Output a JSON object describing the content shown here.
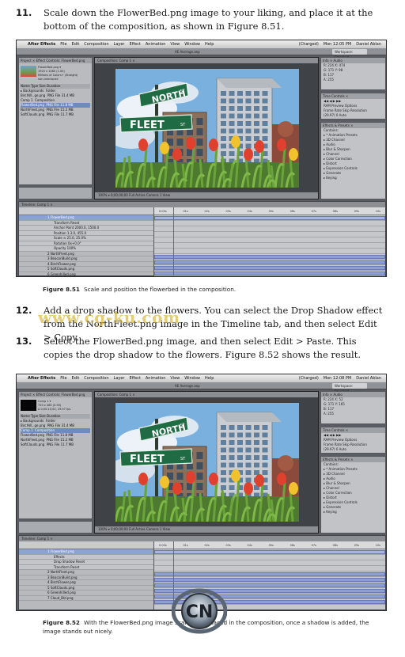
{
  "steps": [
    {
      "num": "11.",
      "text": "Scale down the FlowerBed.png image to your liking, and place it at the bottom of the composition, as shown in Figure 8.51."
    },
    {
      "num": "12.",
      "text": "Add a drop shadow to the flowers. You can select the Drop Shadow effect from the NorthFleet.png image in the Timeline tab, and then select Edit > Copy."
    },
    {
      "num": "13.",
      "text": "Select the FlowerBed.png image, and then select Edit > Paste. This copies the drop shadow to the flowers. Figure 8.52 shows the result."
    }
  ],
  "figures": [
    {
      "menubar": {
        "apple": "",
        "app": "After Effects",
        "items": [
          "File",
          "Edit",
          "Composition",
          "Layer",
          "Effect",
          "Animation",
          "View",
          "Window",
          "Help"
        ],
        "battery": "(Charged)",
        "clock": "Mon 12:05 PM",
        "user": "Daniel Ablan"
      },
      "toolbar": {
        "title": "AE Average.aep",
        "workspace": "Workspace: Standard"
      },
      "project": {
        "tab": "Project ×   Effect Controls: FlowerBed.png",
        "thumb_title": "FlowerBed.png ▾",
        "thumb_info": "1920 x 1080 (1.00)",
        "thumb_note": "Millions of Colors+ (Straight)",
        "thumb_note2": "non-interlaced",
        "columns": "Name       Type    Size   Duration",
        "items": [
          {
            "name": "▸ Backgrounds",
            "type": "Folder",
            "sel": false
          },
          {
            "name": "BirchW...ge.png",
            "type": "PNG File  31.4 MB",
            "sel": false
          },
          {
            "name": "Comp 1",
            "type": "Composition",
            "sel": false
          },
          {
            "name": "FlowerBed.png",
            "type": "PNG File  11.8 MB",
            "sel": true
          },
          {
            "name": "NorthFleet.png",
            "type": "PNG File  15.2 MB",
            "sel": false
          },
          {
            "name": "SoftClouds.png",
            "type": "PNG File  11.7 MB",
            "sel": false
          }
        ]
      },
      "comp": {
        "tab": "Composition: Comp 1 ×",
        "footer": "100%   ▾   0;00;00;00   Full   Active Camera   1 View"
      },
      "scene": {
        "sign1": "NORTH",
        "sign1_suffix": "ST",
        "sign2": "FLEET",
        "sign2_suffix": "ST"
      },
      "info": {
        "title": "Info ×  Audio",
        "rows": [
          "R: 224   X: 474",
          "G: 171   Y: 98",
          "B: 117",
          "A: 255"
        ]
      },
      "time_controls": {
        "title": "Time Controls ×",
        "rows": [
          "◀◀  ◀  ▶  ▶▶",
          "RAM Preview Options",
          "Frame Rate  Skip  Resolution",
          "(29.97)  0   Auto"
        ]
      },
      "effects": {
        "title": "Effects & Presets ×",
        "rows": [
          "Contains:",
          "▸ * Animation Presets",
          "▸ 3D Channel",
          "▸ Audio",
          "▸ Blur & Sharpen",
          "▸ Channel",
          "▸ Color Correction",
          "▸ Distort",
          "▸ Expression Controls",
          "▸ Generate",
          "▸ Keying"
        ]
      },
      "timeline": {
        "tab": "Timeline: Comp 1 ×",
        "ruler": [
          "0:00s",
          "01s",
          "02s",
          "03s",
          "04s",
          "05s",
          "06s",
          "07s",
          "08s",
          "09s",
          "10s"
        ],
        "layers": [
          {
            "name": "1  FlowerBed.png",
            "kind": "sel"
          },
          {
            "name": "Transform           Reset",
            "kind": "sub"
          },
          {
            "name": "Anchor Point   2000.0, 1500.0",
            "kind": "sub"
          },
          {
            "name": "Position        1.3.0, 455.0",
            "kind": "sub"
          },
          {
            "name": "Scale          ⊙ 25.0, 25.0%",
            "kind": "sub"
          },
          {
            "name": "Rotation        0x+0.0°",
            "kind": "sub"
          },
          {
            "name": "Opacity         100%",
            "kind": "sub"
          },
          {
            "name": "2  NorthFleet.png",
            "kind": "layer"
          },
          {
            "name": "3  BeaconBuild.png",
            "kind": "layer"
          },
          {
            "name": "4  BirchFlower.png",
            "kind": "layer"
          },
          {
            "name": "5  SoftClouds.png",
            "kind": "layer"
          },
          {
            "name": "6  Greenhilled.png",
            "kind": "layer"
          },
          {
            "name": "7  Cloud_Bld.png",
            "kind": "layer"
          }
        ]
      }
    },
    {
      "menubar": {
        "apple": "",
        "app": "After Effects",
        "items": [
          "File",
          "Edit",
          "Composition",
          "Layer",
          "Effect",
          "Animation",
          "View",
          "Window",
          "Help"
        ],
        "battery": "(Charged)",
        "clock": "Mon 12:08 PM",
        "user": "Daniel Ablan"
      },
      "toolbar": {
        "title": "AE Average.aep",
        "workspace": "Workspace: Standard"
      },
      "project": {
        "tab": "Project ×   Effect Controls: FlowerBed.png",
        "thumb_title": "Comp 1 ▾",
        "thumb_info": "720 x 480 (0.90)",
        "thumb_note": "Δ 0;00;10;00, 29.97 fps",
        "thumb_note2": "",
        "columns": "Name       Type    Size   Duration",
        "items": [
          {
            "name": "▸ Backgrounds",
            "type": "Folder",
            "sel": false
          },
          {
            "name": "BirchW...ge.png",
            "type": "PNG File  31.4 MB",
            "sel": false
          },
          {
            "name": "Comp 1",
            "type": "Composition",
            "sel": true
          },
          {
            "name": "FlowerBed.png",
            "type": "PNG File  11.8 MB",
            "sel": false
          },
          {
            "name": "NorthFleet.png",
            "type": "PNG File  15.2 MB",
            "sel": false
          },
          {
            "name": "SoftClouds.png",
            "type": "PNG File  11.7 MB",
            "sel": false
          }
        ]
      },
      "comp": {
        "tab": "Composition: Comp 1 ×",
        "footer": "100%   ▾   0;00;00;00   Full   Active Camera   1 View"
      },
      "scene": {
        "sign1": "NORTH",
        "sign1_suffix": "ST",
        "sign2": "FLEET",
        "sign2_suffix": "ST"
      },
      "info": {
        "title": "Info ×  Audio",
        "rows": [
          "R: 224   X: 52",
          "G: 171   Y: 165",
          "B: 117",
          "A: 255"
        ]
      },
      "time_controls": {
        "title": "Time Controls ×",
        "rows": [
          "◀◀  ◀  ▶  ▶▶",
          "RAM Preview Options",
          "Frame Rate  Skip  Resolution",
          "(29.97)  0   Auto"
        ]
      },
      "effects": {
        "title": "Effects & Presets ×",
        "rows": [
          "Contains:",
          "▸ * Animation Presets",
          "▸ 3D Channel",
          "▸ Audio",
          "▸ Blur & Sharpen",
          "▸ Channel",
          "▸ Color Correction",
          "▸ Distort",
          "▸ Expression Controls",
          "▸ Generate",
          "▸ Keying"
        ]
      },
      "timeline": {
        "tab": "Timeline: Comp 1 ×",
        "ruler": [
          "0:00s",
          "01s",
          "02s",
          "03s",
          "04s",
          "05s",
          "06s",
          "07s",
          "08s",
          "09s",
          "10s"
        ],
        "layers": [
          {
            "name": "1  FlowerBed.png",
            "kind": "sel"
          },
          {
            "name": "Effects",
            "kind": "sub"
          },
          {
            "name": "Drop Shadow          Reset",
            "kind": "sub"
          },
          {
            "name": "Transform            Reset",
            "kind": "sub"
          },
          {
            "name": "2  NorthFleet.png",
            "kind": "layer"
          },
          {
            "name": "3  BeaconBuild.png",
            "kind": "layer"
          },
          {
            "name": "4  BirchFlower.png",
            "kind": "layer"
          },
          {
            "name": "5  SoftClouds.png",
            "kind": "layer"
          },
          {
            "name": "6  Greenhilled.png",
            "kind": "layer"
          },
          {
            "name": "7  Cloud_Bld.png",
            "kind": "layer"
          }
        ]
      }
    }
  ],
  "captions": [
    {
      "label": "Figure 8.51",
      "text": "Scale and position the flowerbed in the composition."
    },
    {
      "label": "Figure 8.52",
      "text": "With the FlowerBed.png image scaled and placed in the composition, once a shadow is added, the image stands out nicely."
    }
  ],
  "watermark": "www.cg-ku.com",
  "logo_text": "CN",
  "colors": {
    "selection": "#6d8bbf",
    "playhead": "#e03c1e",
    "layer_bar": "#8f9ed2",
    "sign_green": "#1f6b44"
  }
}
